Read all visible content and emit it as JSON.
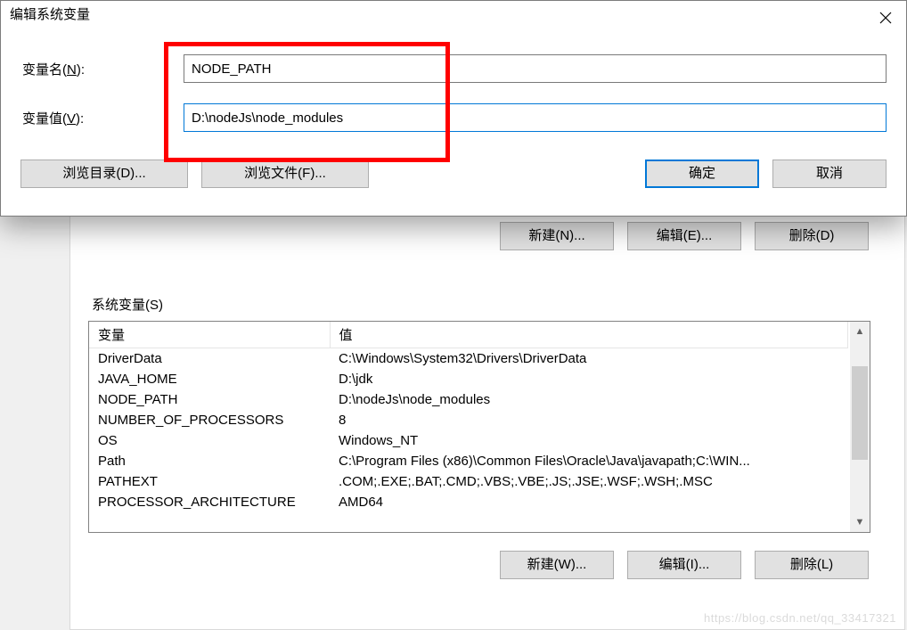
{
  "editDialog": {
    "title": "编辑系统变量",
    "nameLabelPrefix": "变量名(",
    "nameLabelMnemonic": "N",
    "nameLabelSuffix": "):",
    "nameValue": "NODE_PATH",
    "valueLabelPrefix": "变量值(",
    "valueLabelMnemonic": "V",
    "valueLabelSuffix": "):",
    "valueValue": "D:\\nodeJs\\node_modules",
    "browseDirLabel": "浏览目录(D)...",
    "browseFileLabel": "浏览文件(F)...",
    "okLabel": "确定",
    "cancelLabel": "取消"
  },
  "behindButtons": {
    "new": "新建(N)...",
    "edit": "编辑(E)...",
    "delete": "删除(D)"
  },
  "systemVars": {
    "groupLabel": "系统变量(S)",
    "colVar": "变量",
    "colVal": "值",
    "rows": [
      {
        "name": "DriverData",
        "value": "C:\\Windows\\System32\\Drivers\\DriverData"
      },
      {
        "name": "JAVA_HOME",
        "value": "D:\\jdk"
      },
      {
        "name": "NODE_PATH",
        "value": "D:\\nodeJs\\node_modules"
      },
      {
        "name": "NUMBER_OF_PROCESSORS",
        "value": "8"
      },
      {
        "name": "OS",
        "value": "Windows_NT"
      },
      {
        "name": "Path",
        "value": "C:\\Program Files (x86)\\Common Files\\Oracle\\Java\\javapath;C:\\WIN..."
      },
      {
        "name": "PATHEXT",
        "value": ".COM;.EXE;.BAT;.CMD;.VBS;.VBE;.JS;.JSE;.WSF;.WSH;.MSC"
      },
      {
        "name": "PROCESSOR_ARCHITECTURE",
        "value": "AMD64"
      }
    ],
    "newLabel": "新建(W)...",
    "editLabel": "编辑(I)...",
    "deleteLabel": "删除(L)"
  },
  "watermark": "https://blog.csdn.net/qq_33417321"
}
